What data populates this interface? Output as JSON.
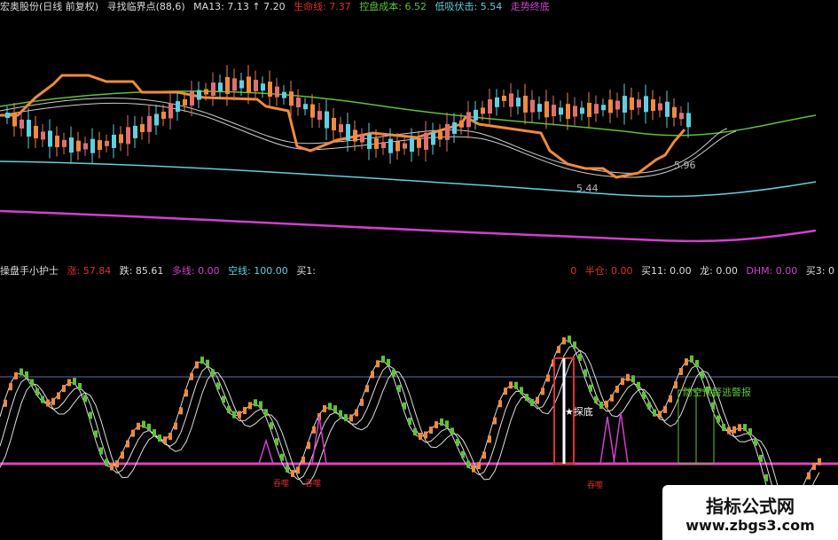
{
  "header": {
    "stock": "宏奥股份(日线 前复权)",
    "find_label": "寻找临界点(88,6)",
    "ma13": "MA13: 7.13 ↑ 7.20",
    "life_line": "生命线: 7.37",
    "control_cost": "控盘成本: 6.52",
    "low_buy": "低吸伏击: 5.54",
    "trend_end": "走势终底"
  },
  "indicator": {
    "name": "操盘手小护士",
    "up": "涨: 57.84",
    "down": "跌: 85.61",
    "long_line": "多线: 0.00",
    "short_line": "空线: 100.00",
    "buy1": "买1:",
    "right_0": "0",
    "half_pos": "半仓: 0.00",
    "buy11": "买11: 0.00",
    "dragon_star": "龙: 0.00",
    "dhm": "DHM: 0.00",
    "buy3": "买3: 0"
  },
  "annotations": {
    "price_high": "5.96",
    "price_low": "5.44",
    "bottom_detect": "★探底",
    "warn": "防空预警逃警报",
    "small_labels": [
      "吞噬",
      "吞噬",
      "吞噬"
    ]
  },
  "watermark": {
    "title": "指标公式网",
    "url": "www.zbgs3.com"
  },
  "colors": {
    "orange": "#f08a3c",
    "cyan": "#5fd0e0",
    "green": "#5ec236",
    "magenta": "#d040d0",
    "red": "#e03030",
    "white": "#ffffff"
  }
}
